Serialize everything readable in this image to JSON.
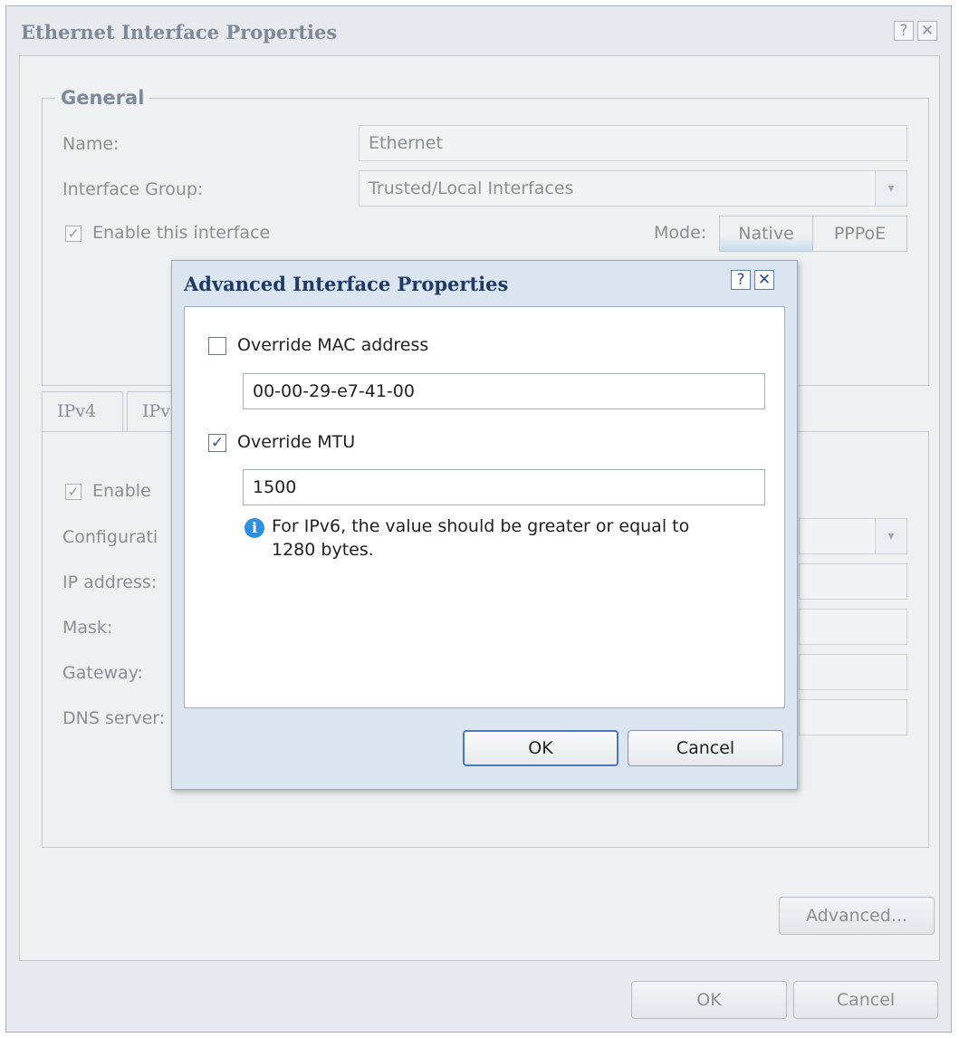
{
  "outer_dialog": {
    "title": "Ethernet Interface Properties",
    "help_glyph": "?",
    "close_glyph": "✕",
    "general": {
      "legend": "General",
      "name_label": "Name:",
      "name_value": "Ethernet",
      "group_label": "Interface Group:",
      "group_value": "Trusted/Local Interfaces",
      "enable_label": "Enable this interface",
      "enable_checked": true,
      "mode_label": "Mode:",
      "mode_options": [
        "Native",
        "PPPoE"
      ],
      "mode_selected": "Native"
    },
    "tabs": [
      "IPv4",
      "IPv"
    ],
    "ipv4": {
      "enable_label": "Enable",
      "enable_checked": true,
      "config_label": "Configurati",
      "ip_label": "IP address:",
      "mask_label": "Mask:",
      "gateway_label": "Gateway:",
      "dns_label": "DNS server:"
    },
    "advanced_button": "Advanced...",
    "ok_button": "OK",
    "cancel_button": "Cancel"
  },
  "modal": {
    "title": "Advanced Interface Properties",
    "help_glyph": "?",
    "close_glyph": "✕",
    "override_mac_label": "Override MAC address",
    "override_mac_checked": false,
    "mac_value": "00-00-29-e7-41-00",
    "override_mtu_label": "Override MTU",
    "override_mtu_checked": true,
    "mtu_value": "1500",
    "info_glyph": "i",
    "info_line1": "For IPv6, the value should be greater or equal to",
    "info_line2": "1280 bytes.",
    "ok_button": "OK",
    "cancel_button": "Cancel"
  },
  "check_glyph": "✓",
  "combo_glyph": "▾",
  "colors": {
    "modal_title": "#1f3a66",
    "info_icon": "#2f8fe0",
    "checkbox_mark": "#2d58a6"
  }
}
